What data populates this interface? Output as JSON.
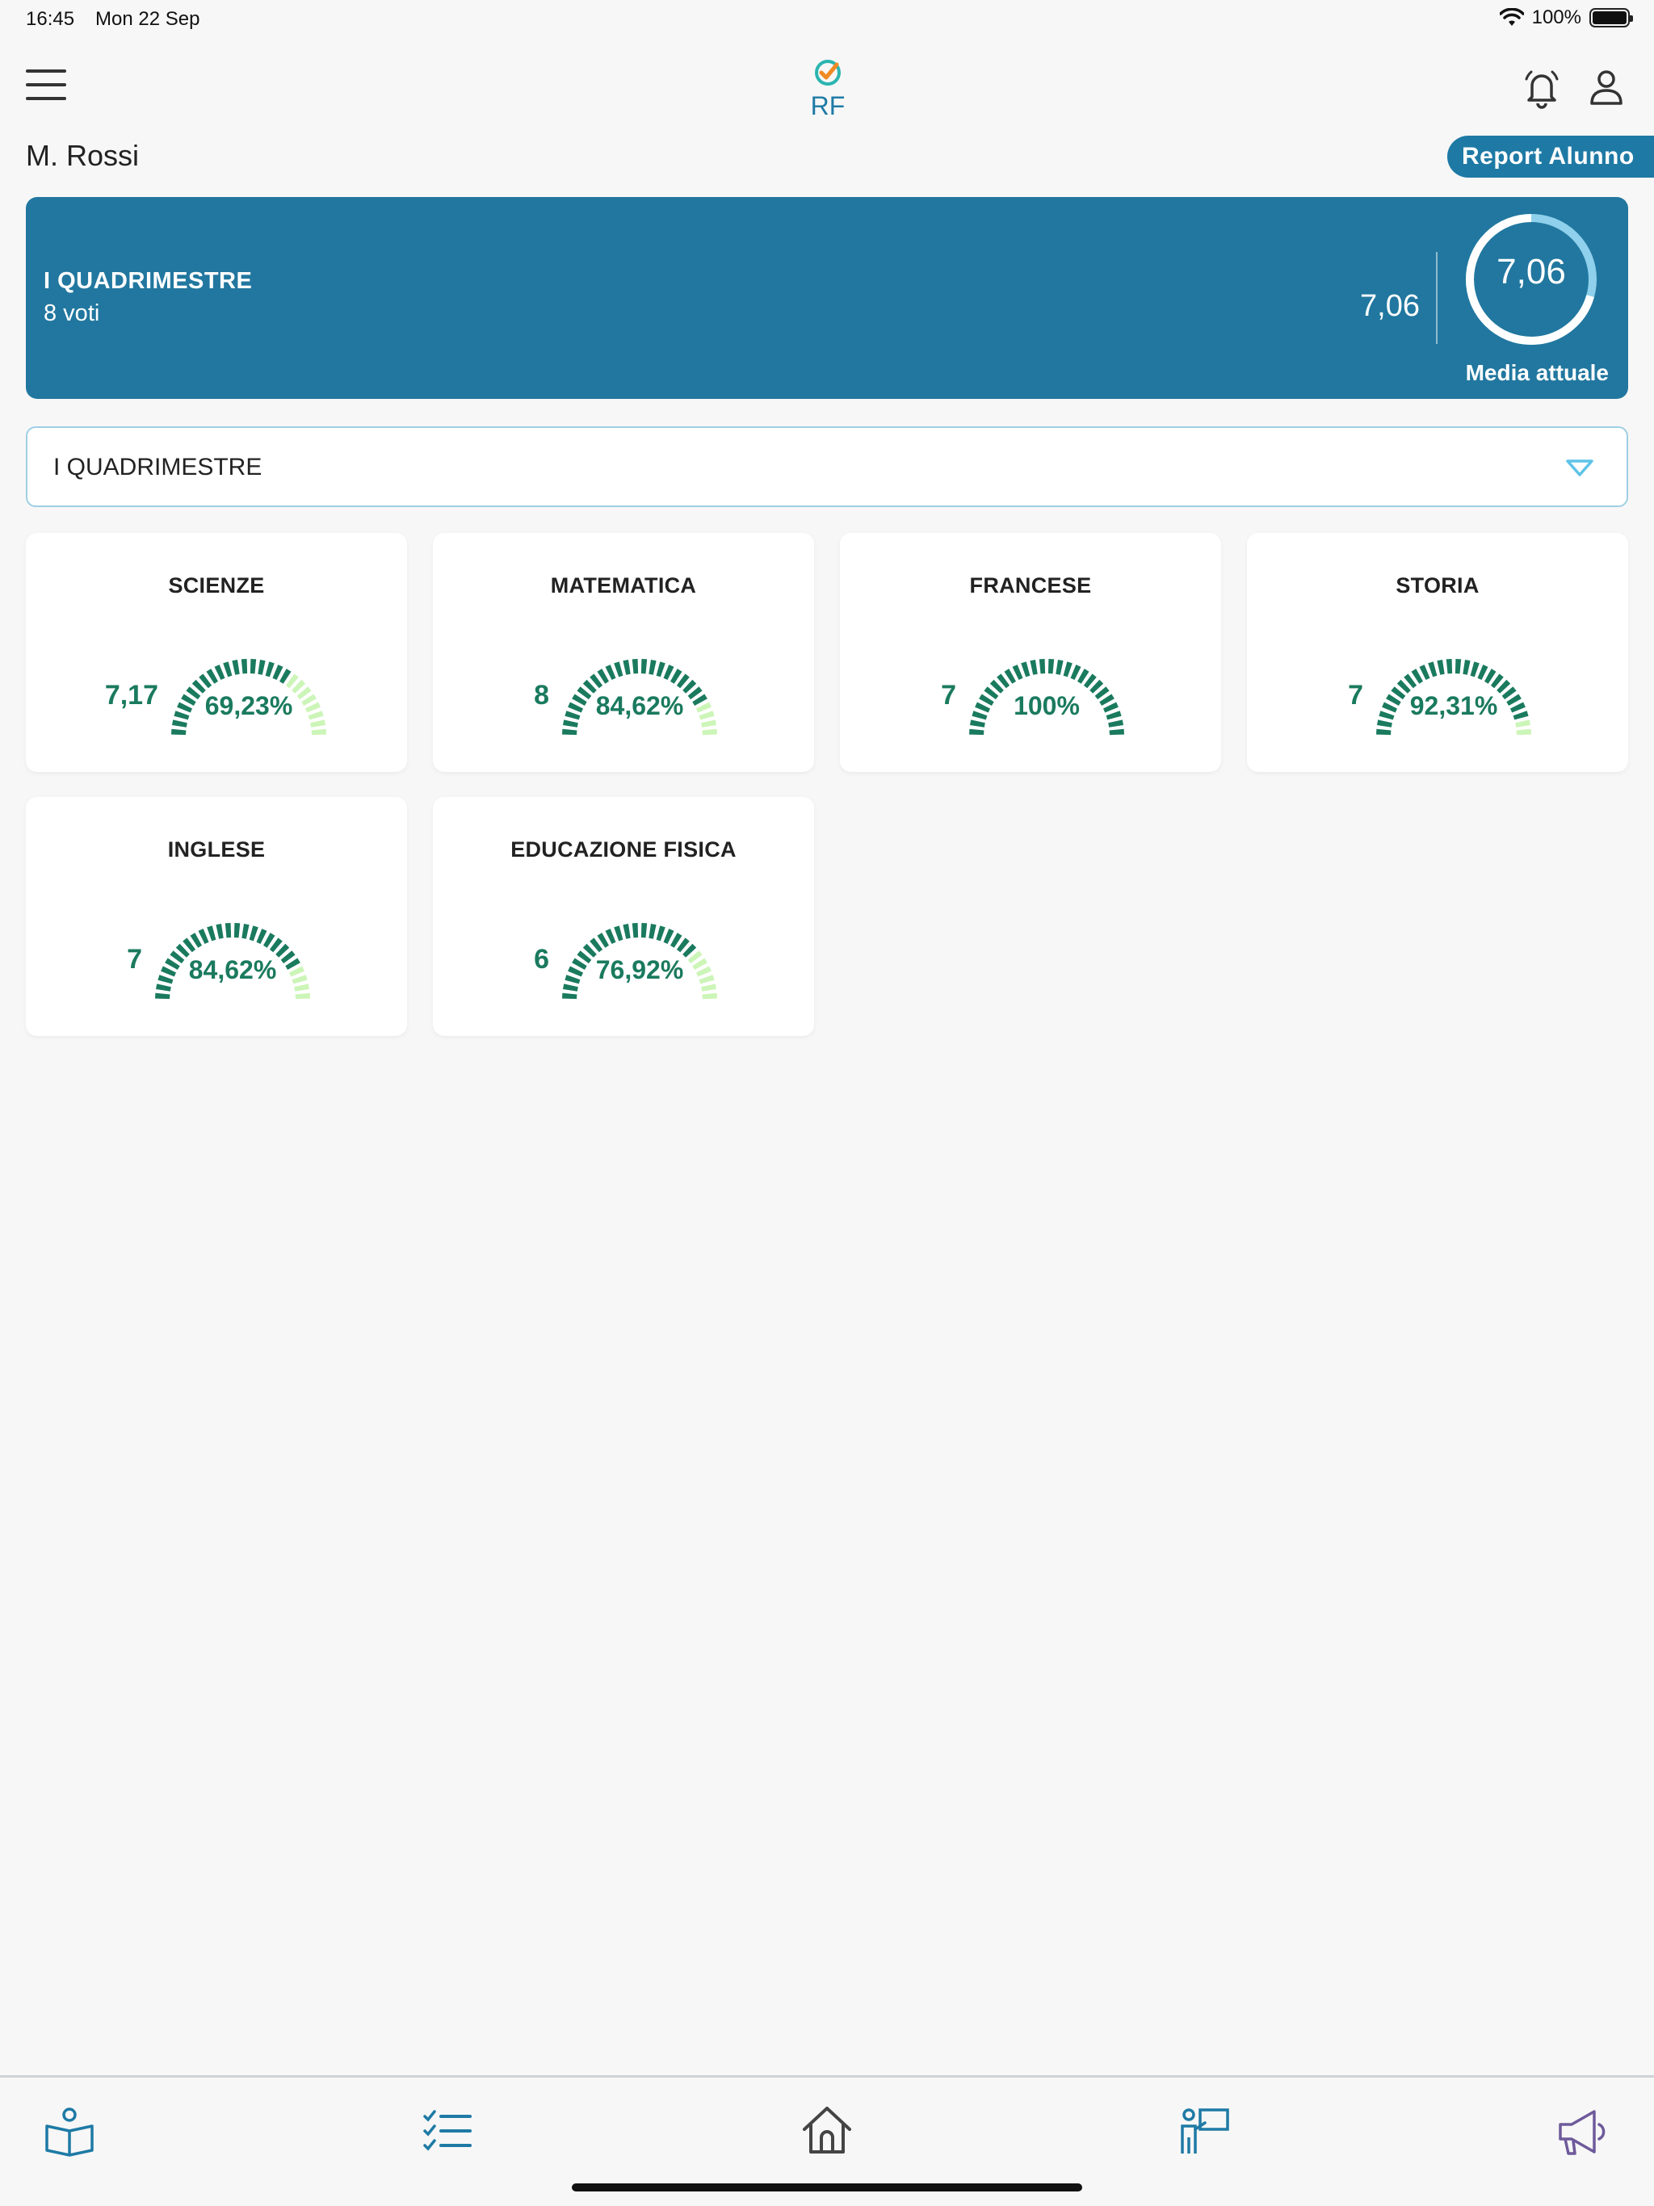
{
  "status": {
    "time": "16:45",
    "date": "Mon 22 Sep",
    "battery": "100%"
  },
  "header": {
    "logo_text": "RF",
    "student_name": "M. Rossi",
    "report_button": "Report Alunno"
  },
  "summary": {
    "period": "I QUADRIMESTRE",
    "count": "8 voti",
    "average": "7,06",
    "ring_value": "7,06",
    "ring_label": "Media attuale",
    "ring_fraction": 0.706,
    "colors": {
      "card": "#21779f",
      "ring": "#ffffff",
      "ring_track": "#8fd0ec"
    }
  },
  "period_select": {
    "value": "I QUADRIMESTRE"
  },
  "subjects": [
    {
      "name": "SCIENZE",
      "grade": "7,17",
      "percent": "69,23%",
      "fraction": 0.6923
    },
    {
      "name": "MATEMATICA",
      "grade": "8",
      "percent": "84,62%",
      "fraction": 0.8462
    },
    {
      "name": "FRANCESE",
      "grade": "7",
      "percent": "100%",
      "fraction": 1.0
    },
    {
      "name": "STORIA",
      "grade": "7",
      "percent": "92,31%",
      "fraction": 0.9231
    },
    {
      "name": "INGLESE",
      "grade": "7",
      "percent": "84,62%",
      "fraction": 0.8462
    },
    {
      "name": "EDUCAZIONE FISICA",
      "grade": "6",
      "percent": "76,92%",
      "fraction": 0.7692
    }
  ],
  "gauge_colors": {
    "filled": "#1a7a5e",
    "empty": "#ccf5b8"
  },
  "tabbar": {
    "items": [
      "book-icon",
      "checklist-icon",
      "home-icon",
      "teacher-board-icon",
      "megaphone-icon"
    ],
    "colors": {
      "default": "#1e7aa5",
      "home": "#444444",
      "announce": "#6e5a9a"
    }
  }
}
